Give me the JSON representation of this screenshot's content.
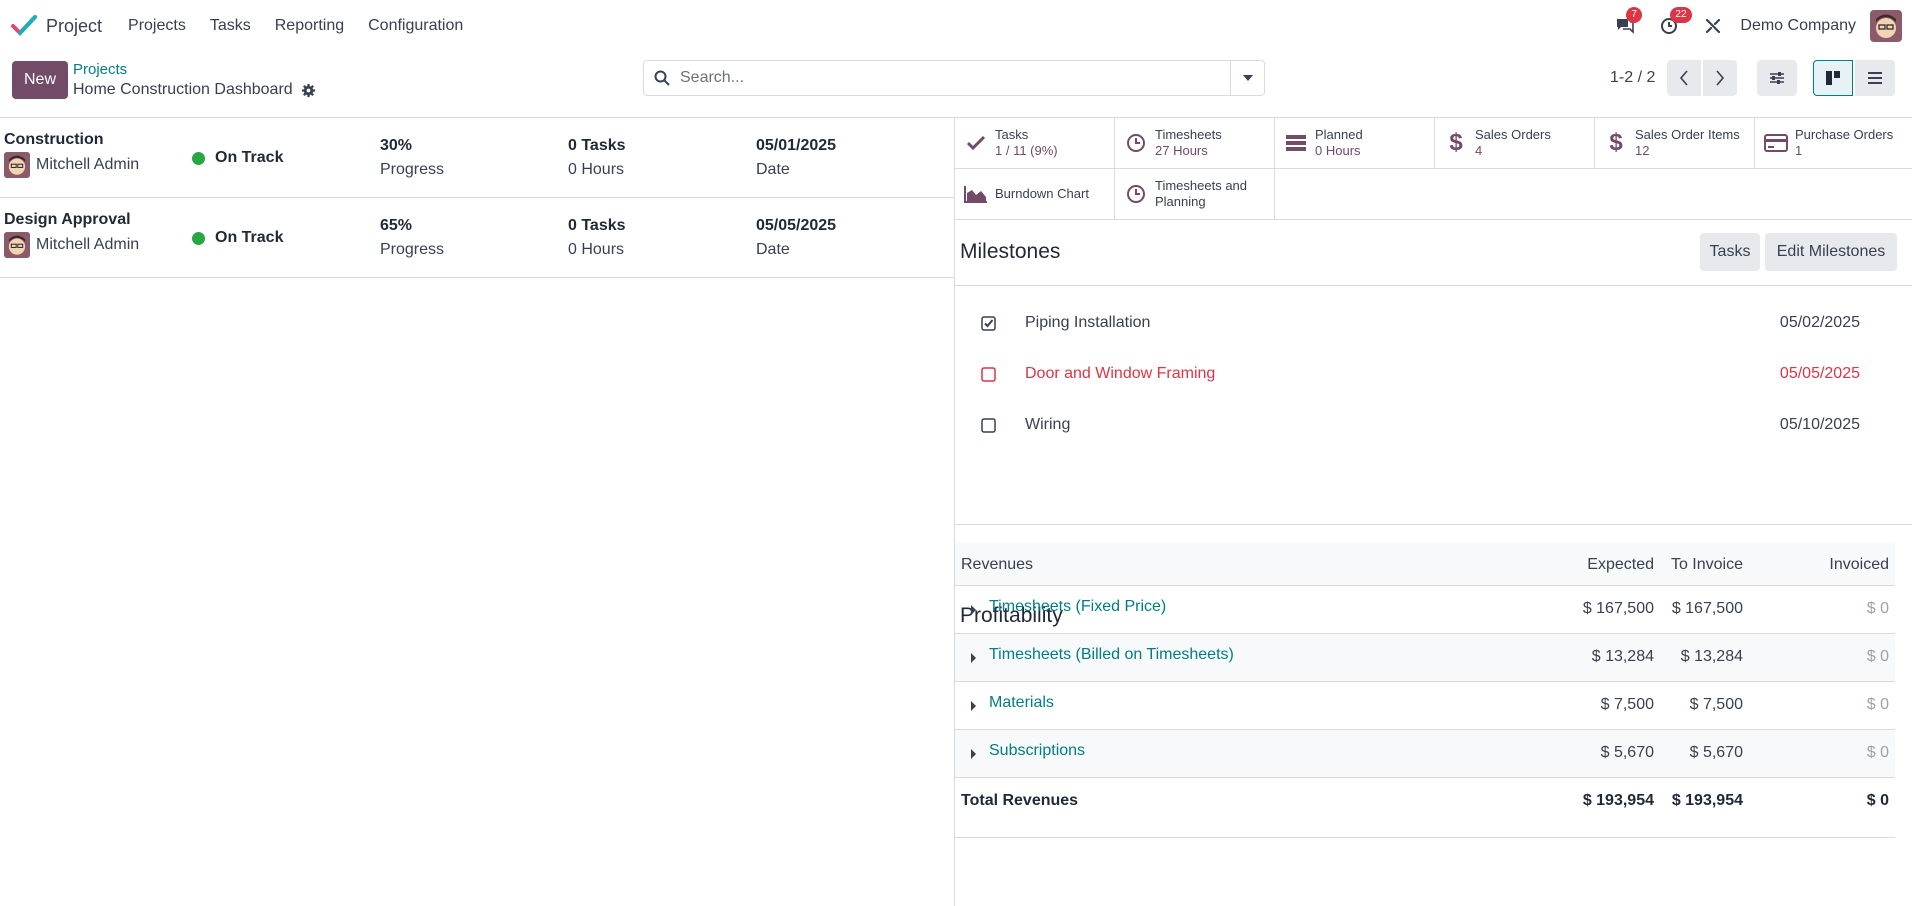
{
  "app": {
    "name": "Project",
    "menu": [
      "Projects",
      "Tasks",
      "Reporting",
      "Configuration"
    ],
    "messages_count": "7",
    "activities_count": "22",
    "company": "Demo Company"
  },
  "control": {
    "new_label": "New",
    "breadcrumb_parent": "Projects",
    "breadcrumb_current": "Home Construction Dashboard",
    "search_placeholder": "Search...",
    "pager": "1-2 / 2"
  },
  "projects": [
    {
      "name": "Construction",
      "user": "Mitchell Admin",
      "status": "On Track",
      "progress_value": "30%",
      "progress_label": "Progress",
      "tasks": "0 Tasks",
      "hours": "0 Hours",
      "date": "05/01/2025",
      "date_label": "Date"
    },
    {
      "name": "Design Approval",
      "user": "Mitchell Admin",
      "status": "On Track",
      "progress_value": "65%",
      "progress_label": "Progress",
      "tasks": "0 Tasks",
      "hours": "0 Hours",
      "date": "05/05/2025",
      "date_label": "Date"
    }
  ],
  "stats": [
    {
      "label": "Tasks",
      "value": "1 / 11 (9%)",
      "icon": "check-icon"
    },
    {
      "label": "Timesheets",
      "value": "27 Hours",
      "icon": "clock-icon"
    },
    {
      "label": "Planned",
      "value": "0 Hours",
      "icon": "tasks-icon"
    },
    {
      "label": "Sales Orders",
      "value": "4",
      "icon": "dollar-icon"
    },
    {
      "label": "Sales Order Items",
      "value": "12",
      "icon": "dollar-icon"
    },
    {
      "label": "Purchase Orders",
      "value": "1",
      "icon": "credit-card-icon"
    },
    {
      "label": "Burndown Chart",
      "value": "",
      "icon": "area-chart-icon"
    },
    {
      "label": "Timesheets and Planning",
      "value": "",
      "icon": "clock-icon"
    }
  ],
  "milestones": {
    "title": "Milestones",
    "tasks_button": "Tasks",
    "edit_button": "Edit Milestones",
    "items": [
      {
        "name": "Piping Installation",
        "date": "05/02/2025",
        "done": true,
        "late": false
      },
      {
        "name": "Door and Window Framing",
        "date": "05/05/2025",
        "done": false,
        "late": true
      },
      {
        "name": "Wiring",
        "date": "05/10/2025",
        "done": false,
        "late": false
      }
    ]
  },
  "profitability": {
    "title": "Profitability",
    "headers": [
      "Revenues",
      "Expected",
      "To Invoice",
      "Invoiced"
    ],
    "rows": [
      {
        "name": "Timesheets (Fixed Price)",
        "expected": "$ 167,500",
        "to_invoice": "$ 167,500",
        "invoiced": "$ 0"
      },
      {
        "name": "Timesheets (Billed on Timesheets)",
        "expected": "$ 13,284",
        "to_invoice": "$ 13,284",
        "invoiced": "$ 0"
      },
      {
        "name": "Materials",
        "expected": "$ 7,500",
        "to_invoice": "$ 7,500",
        "invoiced": "$ 0"
      },
      {
        "name": "Subscriptions",
        "expected": "$ 5,670",
        "to_invoice": "$ 5,670",
        "invoiced": "$ 0"
      }
    ],
    "total": {
      "name": "Total Revenues",
      "expected": "$ 193,954",
      "to_invoice": "$ 193,954",
      "invoiced": "$ 0"
    }
  },
  "colors": {
    "brand": "#714b67",
    "link": "#017e84",
    "status_green": "#28a745",
    "late_red": "#dc3545"
  }
}
